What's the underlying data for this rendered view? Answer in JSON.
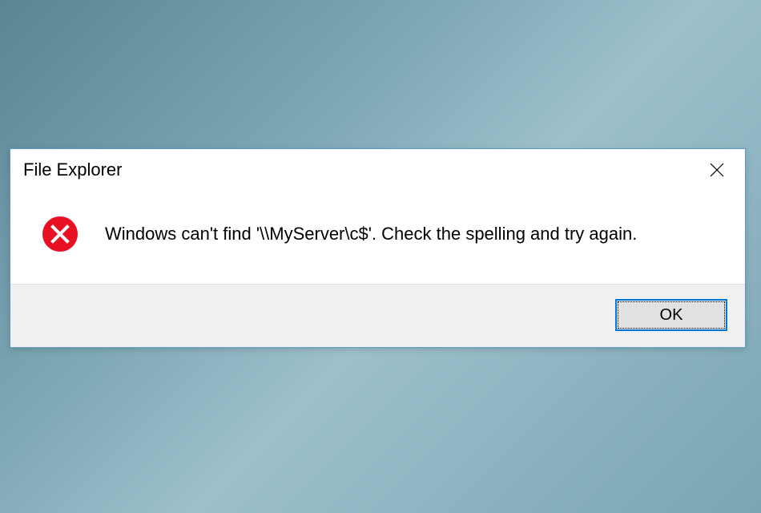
{
  "dialog": {
    "title": "File Explorer",
    "message": "Windows can't find '\\\\MyServer\\c$'. Check the spelling and try again.",
    "ok_label": "OK"
  }
}
